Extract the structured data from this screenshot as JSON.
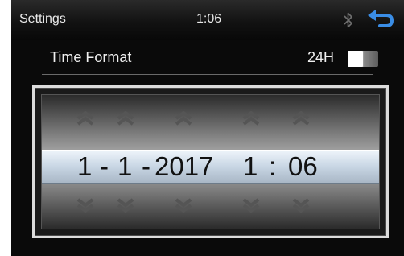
{
  "status_bar": {
    "title": "Settings",
    "clock": "1:06",
    "bluetooth_icon": "bluetooth-icon",
    "back_icon": "back-arrow-icon"
  },
  "time_format": {
    "label": "Time Format",
    "value": "24H",
    "toggle_on": true
  },
  "picker": {
    "month": "1",
    "sep1": "-",
    "day": "1",
    "sep2": "-",
    "year": "2017",
    "hour": "1",
    "colon": ":",
    "minute": "06",
    "up_icon": "chevron-up-icon",
    "down_icon": "chevron-down-icon"
  },
  "colors": {
    "background": "#0a0a0a",
    "accent_blue": "#3a8de6",
    "band": "#c8d6e4"
  }
}
